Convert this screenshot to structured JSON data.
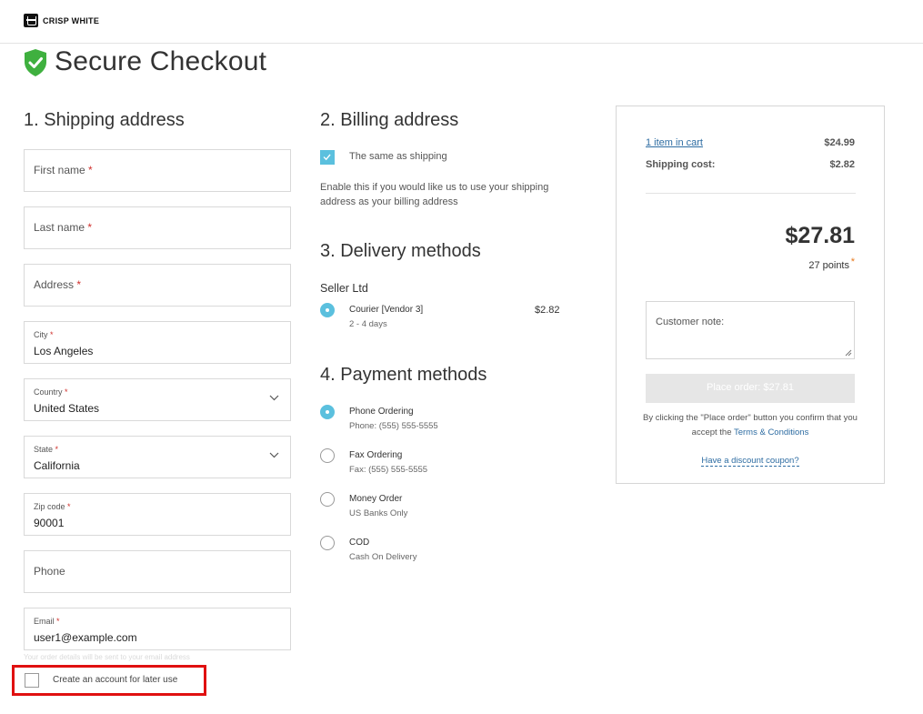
{
  "header": {
    "brand": "CRISP WHITE"
  },
  "page": {
    "title": "Secure Checkout"
  },
  "shipping": {
    "heading": "1.  Shipping address",
    "first_name": "First name",
    "last_name": "Last name",
    "address": "Address",
    "city_label": "City",
    "city_value": "Los Angeles",
    "country_label": "Country",
    "country_value": "United States",
    "state_label": "State",
    "state_value": "California",
    "zip_label": "Zip code",
    "zip_value": "90001",
    "phone": "Phone",
    "email_label": "Email",
    "email_value": "user1@example.com",
    "email_hint": "Your order details will be sent to your email address",
    "create_account": "Create an account for later use",
    "required_mark": "*"
  },
  "billing": {
    "heading": "2.  Billing address",
    "same_label": "The same as shipping",
    "help": "Enable this if you would like us to use your shipping address as your billing address"
  },
  "delivery": {
    "heading": "3.  Delivery methods",
    "seller": "Seller Ltd",
    "method_title": "Courier [Vendor 3]",
    "method_sub": "2 - 4 days",
    "method_price": "$2.82"
  },
  "payment": {
    "heading": "4.  Payment methods",
    "methods": [
      {
        "title": "Phone Ordering",
        "sub": "Phone: (555) 555-5555",
        "selected": true
      },
      {
        "title": "Fax Ordering",
        "sub": "Fax: (555) 555-5555",
        "selected": false
      },
      {
        "title": "Money Order",
        "sub": "US Banks Only",
        "selected": false
      },
      {
        "title": "COD",
        "sub": "Cash On Delivery",
        "selected": false
      }
    ]
  },
  "summary": {
    "cart_link": "1 item in cart",
    "cart_amount": "$24.99",
    "shipping_label": "Shipping cost:",
    "shipping_amount": "$2.82",
    "total": "$27.81",
    "points": "27 points",
    "points_mark": "*",
    "note_placeholder": "Customer note:",
    "place_order": "Place order: $27.81",
    "confirm_text": "By clicking the \"Place order\" button you confirm that you accept the",
    "terms_link": "Terms & Conditions",
    "coupon": "Have a discount coupon?"
  },
  "colors": {
    "accent": "#5bc0de",
    "link": "#2d6ca2",
    "required": "#d0312d",
    "shield": "#3fb03f",
    "highlight": "#e01010"
  }
}
